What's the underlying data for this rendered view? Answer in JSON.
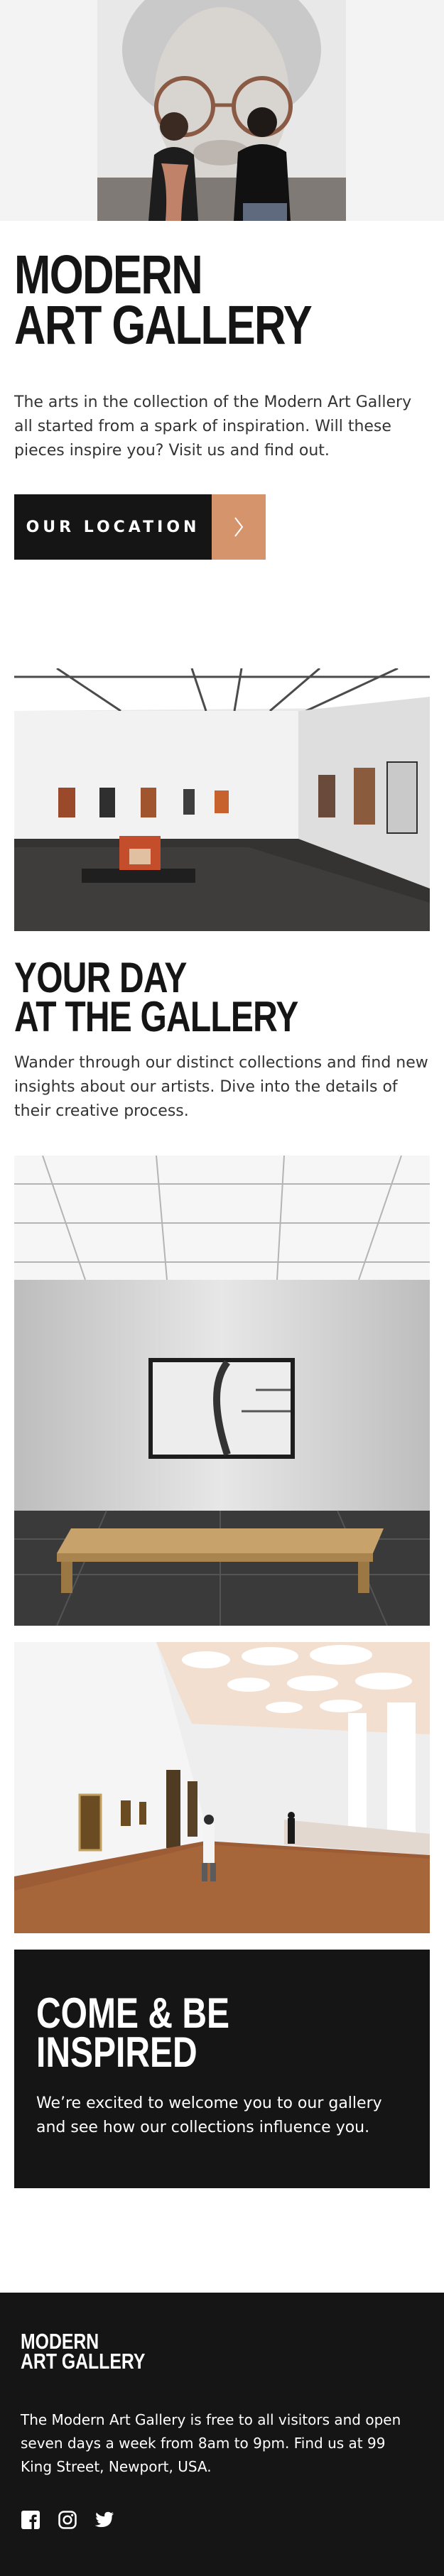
{
  "hero": {
    "title_line1": "Modern",
    "title_line2": "Art Gallery",
    "text": "The arts in the collection of the Modern Art Gallery all started from a spark of inspiration. Will these pieces inspire you? Visit us and find out.",
    "button_label": "Our Location",
    "button_icon": "chevron-right-icon"
  },
  "gallery": {
    "title_line1": "Your Day",
    "title_line2": "at the Gallery",
    "text": "Wander through our distinct collections and find new insights about our artists. Dive into the details of their creative process."
  },
  "inspired": {
    "title_line1": "Come & Be",
    "title_line2": "Inspired",
    "text": "We’re excited to welcome you to our gallery and see how our collections influence you."
  },
  "footer": {
    "logo_line1": "Modern",
    "logo_line2": "Art Gallery",
    "text": "The Modern Art Gallery is free to all visitors and open seven days a week from 8am to 9pm. Find us at 99 King Street, Newport, USA.",
    "socials": [
      "facebook-icon",
      "instagram-icon",
      "twitter-icon"
    ]
  },
  "colors": {
    "dark": "#151515",
    "accent": "#d5946c",
    "white": "#ffffff"
  }
}
